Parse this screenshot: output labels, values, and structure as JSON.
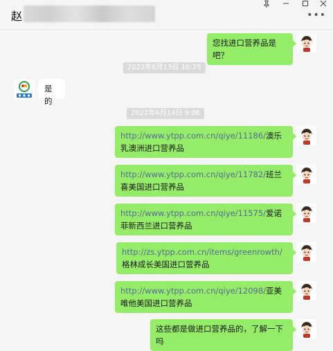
{
  "window": {
    "title": "赵",
    "pin_icon": "pin-icon",
    "minimize_icon": "minimize-icon",
    "maximize_icon": "maximize-icon",
    "close_icon": "close-icon",
    "more_icon": "more-icon"
  },
  "chat": {
    "timestamps": [
      "2022年6月13日 16:25",
      "2022年6月14日 9:06"
    ],
    "messages": [
      {
        "side": "out",
        "text": "您找进口营养品是吧？"
      },
      {
        "side": "in",
        "text": "是的"
      },
      {
        "side": "out",
        "link": "http://www.ytpp.com.cn/qiye/11186/",
        "text": "澳乐乳澳洲进口营养品"
      },
      {
        "side": "out",
        "link": "http://www.ytpp.com.cn/qiye/11782/",
        "text": "班兰喜美国进口营养品"
      },
      {
        "side": "out",
        "link": "http://www.ytpp.com.cn/qiye/11575/",
        "text": "爱诺菲新西兰进口营养品"
      },
      {
        "side": "out",
        "link": "http://zs.ytpp.com.cn/items/greenrowth/",
        "text": "格林成长美国进口营养品"
      },
      {
        "side": "out",
        "link": "http://www.ytpp.com.cn/qiye/12098/",
        "text": "亚美唯他美国进口营养品"
      },
      {
        "side": "out",
        "text": "这些都是做进口营养品的，了解一下吗"
      }
    ]
  },
  "colors": {
    "bubble_out": "#95ec69",
    "bubble_in": "#ffffff",
    "background": "#f5f5f5",
    "link": "#576b95"
  }
}
